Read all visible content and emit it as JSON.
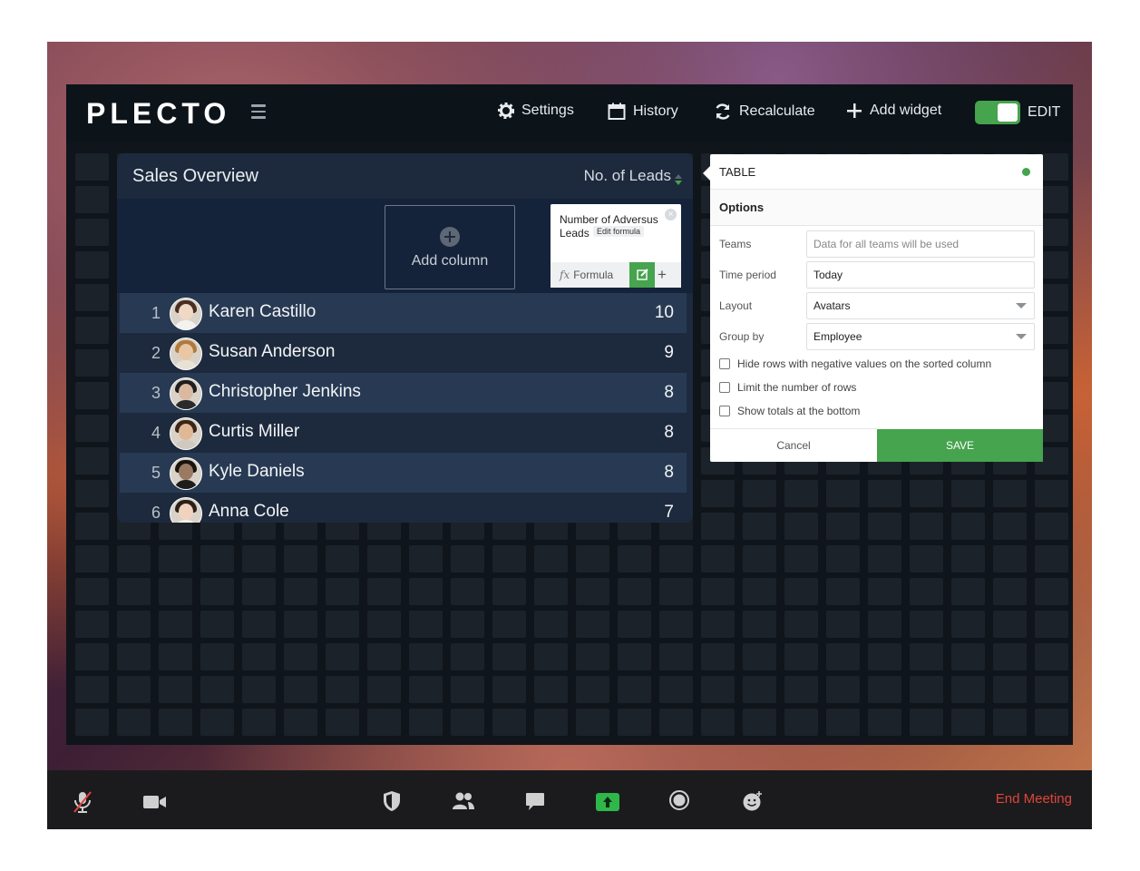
{
  "app": {
    "logo": "PLECTO"
  },
  "topbar": {
    "settings_label": "Settings",
    "history_label": "History",
    "recalculate_label": "Recalculate",
    "add_widget_label": "Add widget",
    "edit_label": "EDIT",
    "edit_toggle_on": true
  },
  "widget": {
    "title": "Sales Overview",
    "column_header": "No. of Leads",
    "add_column_label": "Add column",
    "column_card": {
      "title": "Number of Adversus Leads",
      "formula_label": "Formula",
      "edit_tooltip": "Edit formula"
    },
    "rows": [
      {
        "rank": "1",
        "name": "Karen Castillo",
        "value": "10"
      },
      {
        "rank": "2",
        "name": "Susan Anderson",
        "value": "9"
      },
      {
        "rank": "3",
        "name": "Christopher Jenkins",
        "value": "8"
      },
      {
        "rank": "4",
        "name": "Curtis Miller",
        "value": "8"
      },
      {
        "rank": "5",
        "name": "Kyle Daniels",
        "value": "8"
      },
      {
        "rank": "6",
        "name": "Anna Cole",
        "value": "7"
      }
    ]
  },
  "options_panel": {
    "header": "TABLE",
    "section": "Options",
    "teams_label": "Teams",
    "teams_placeholder": "Data for all teams will be used",
    "time_period_label": "Time period",
    "time_period_value": "Today",
    "layout_label": "Layout",
    "layout_value": "Avatars",
    "group_by_label": "Group by",
    "group_by_value": "Employee",
    "checkboxes": [
      "Hide rows with negative values on the sorted column",
      "Limit the number of rows",
      "Show totals at the bottom"
    ],
    "cancel_label": "Cancel",
    "save_label": "SAVE",
    "status_color": "#46a34e"
  },
  "meeting": {
    "end_label": "End Meeting",
    "icons": [
      "mic-muted-icon",
      "video-icon",
      "security-icon",
      "participants-icon",
      "chat-icon",
      "share-screen-icon",
      "record-icon",
      "reactions-icon"
    ]
  },
  "colors": {
    "accent_green": "#46a34e",
    "end_meeting_red": "#e0453b"
  }
}
